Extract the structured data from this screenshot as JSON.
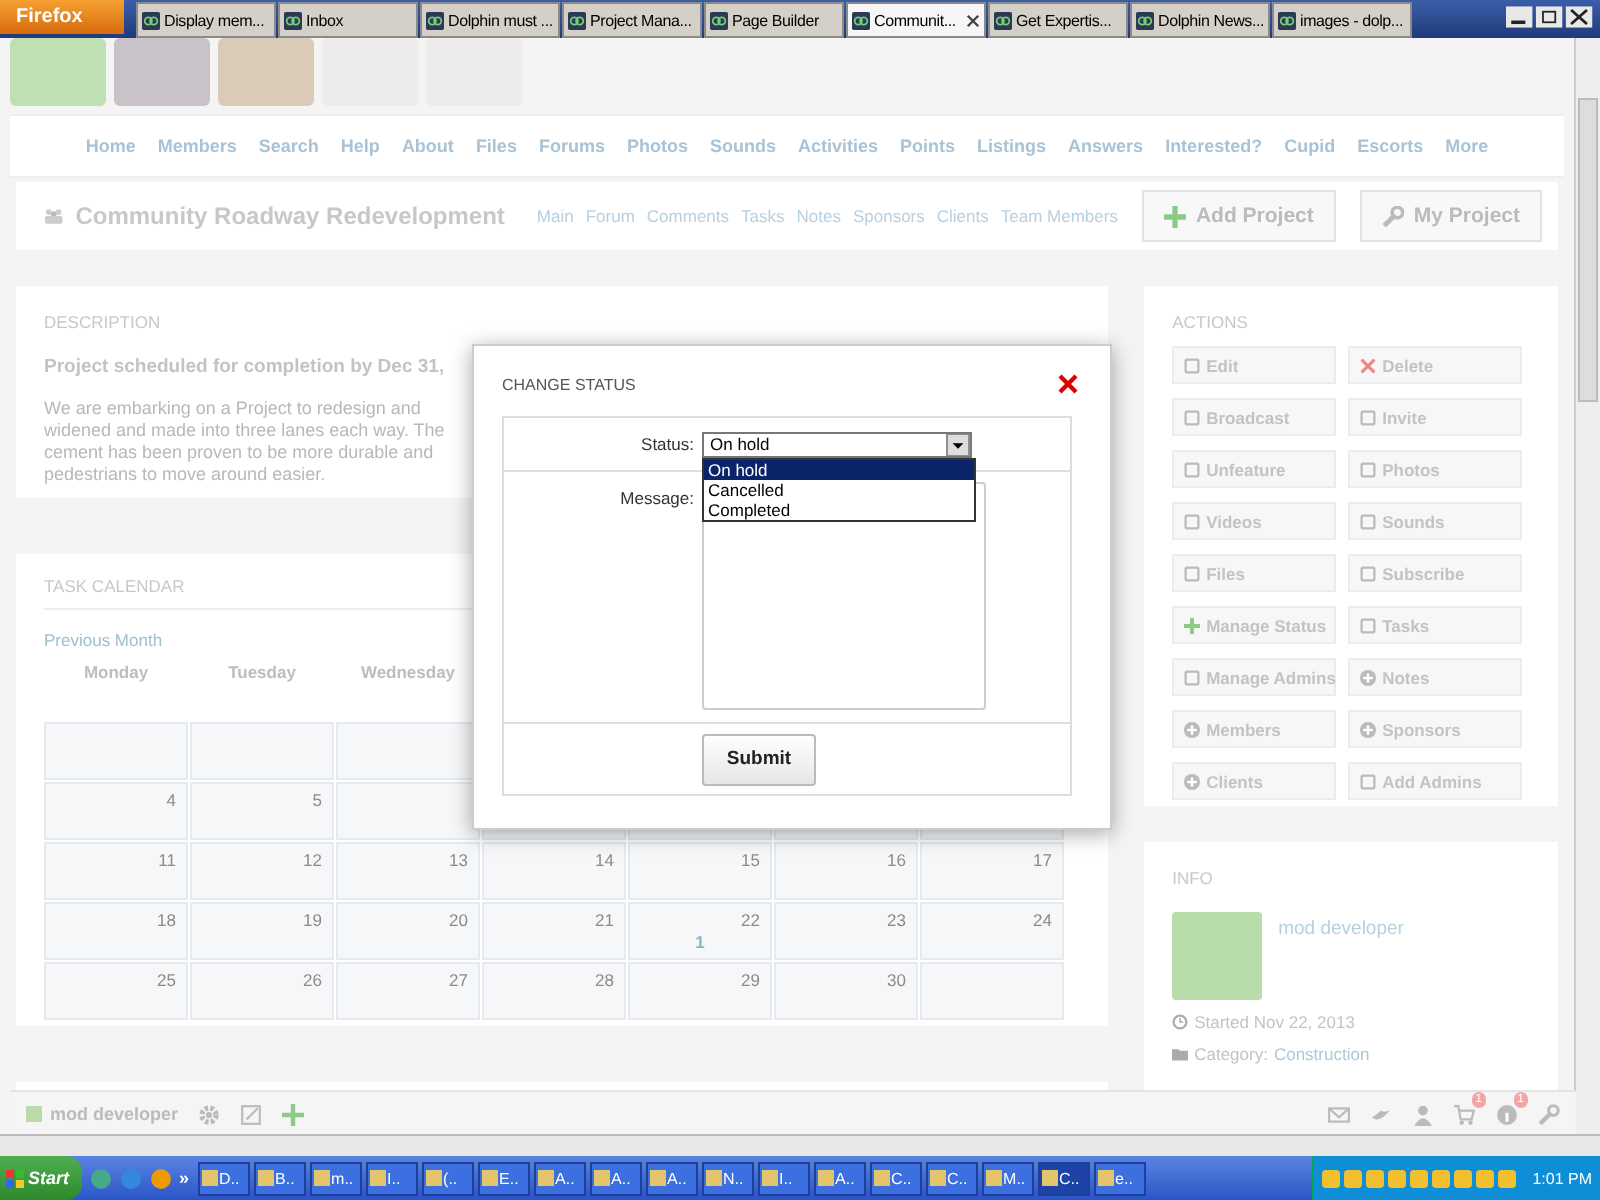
{
  "browser": {
    "menu_button": "Firefox",
    "tabs": [
      {
        "title": "Display mem...",
        "selected": false
      },
      {
        "title": "Inbox",
        "selected": false
      },
      {
        "title": "Dolphin must ...",
        "selected": false
      },
      {
        "title": "Project Mana...",
        "selected": false
      },
      {
        "title": "Page Builder",
        "selected": false
      },
      {
        "title": "Communit...",
        "selected": true
      },
      {
        "title": "Get Expertis...",
        "selected": false
      },
      {
        "title": "Dolphin News...",
        "selected": false
      },
      {
        "title": "images - dolp...",
        "selected": false
      }
    ]
  },
  "nav": [
    "Home",
    "Members",
    "Search",
    "Help",
    "About",
    "Files",
    "Forums",
    "Photos",
    "Sounds",
    "Activities",
    "Points",
    "Listings",
    "Answers",
    "Interested?",
    "Cupid",
    "Escorts",
    "More"
  ],
  "header": {
    "title": "Community Roadway Redevelopment",
    "links": [
      "Main",
      "Forum",
      "Comments",
      "Tasks",
      "Notes",
      "Sponsors",
      "Clients",
      "Team Members"
    ],
    "buttons": [
      "Add Project",
      "My Project"
    ]
  },
  "description": {
    "heading": "DESCRIPTION",
    "lead": "Project scheduled for completion by Dec 31,",
    "body_lines": [
      "We are embarking on a Project to redesign and",
      "widened and made into three lanes each way. The",
      "cement has been proven to be more durable and",
      "pedestrians to move around easier."
    ]
  },
  "calendar": {
    "heading": "TASK CALENDAR",
    "previous": "Previous Month",
    "weekdays": [
      "Monday",
      "Tuesday",
      "Wednesday"
    ],
    "rows": [
      [
        null,
        null,
        null,
        null,
        null,
        null,
        null
      ],
      [
        {
          "day": "4"
        },
        {
          "day": "5"
        },
        null,
        null,
        null,
        null,
        null
      ],
      [
        {
          "day": "11"
        },
        {
          "day": "12"
        },
        {
          "day": "13"
        },
        {
          "day": "14"
        },
        {
          "day": "15"
        },
        {
          "day": "16"
        },
        {
          "day": "17"
        }
      ],
      [
        {
          "day": "18"
        },
        {
          "day": "19"
        },
        {
          "day": "20"
        },
        {
          "day": "21"
        },
        {
          "day": "22",
          "count": "1"
        },
        {
          "day": "23"
        },
        {
          "day": "24"
        }
      ],
      [
        {
          "day": "25"
        },
        {
          "day": "26"
        },
        {
          "day": "27"
        },
        {
          "day": "28"
        },
        {
          "day": "29"
        },
        {
          "day": "30"
        },
        null
      ]
    ]
  },
  "actions": {
    "heading": "ACTIONS",
    "items": [
      "Edit",
      "Delete",
      "Broadcast",
      "Invite",
      "Unfeature",
      "Photos",
      "Videos",
      "Sounds",
      "Files",
      "Subscribe",
      "Manage Status",
      "Tasks",
      "Manage Admins",
      "Notes",
      "Members",
      "Sponsors",
      "Clients",
      "Add Admins"
    ]
  },
  "info": {
    "heading": "INFO",
    "author": "mod developer",
    "started": "Started Nov 22, 2013",
    "category_label": "Category:",
    "category": "Construction"
  },
  "dialog": {
    "title": "CHANGE STATUS",
    "status_label": "Status:",
    "status_value": "On hold",
    "options": [
      {
        "label": "On hold",
        "selected": true
      },
      {
        "label": "Cancelled",
        "selected": false
      },
      {
        "label": "Completed",
        "selected": false
      }
    ],
    "message_label": "Message:",
    "submit": "Submit"
  },
  "toolbar": {
    "user": "mod developer",
    "badges": [
      "1",
      "1"
    ]
  },
  "taskbar": {
    "start": "Start",
    "more": "»",
    "items": [
      {
        "label": "D..",
        "selected": false
      },
      {
        "label": "B..",
        "selected": false
      },
      {
        "label": "m..",
        "selected": false
      },
      {
        "label": "I..",
        "selected": false
      },
      {
        "label": "(..",
        "selected": false
      },
      {
        "label": "E..",
        "selected": false
      },
      {
        "label": "A..",
        "selected": false
      },
      {
        "label": "A..",
        "selected": false
      },
      {
        "label": "A..",
        "selected": false
      },
      {
        "label": "N..",
        "selected": false
      },
      {
        "label": "I..",
        "selected": false
      },
      {
        "label": "A..",
        "selected": false
      },
      {
        "label": "C..",
        "selected": false
      },
      {
        "label": "C..",
        "selected": false
      },
      {
        "label": "M..",
        "selected": false
      },
      {
        "label": "C..",
        "selected": true
      },
      {
        "label": "e..",
        "selected": false
      }
    ],
    "clock": "1:01 PM"
  }
}
